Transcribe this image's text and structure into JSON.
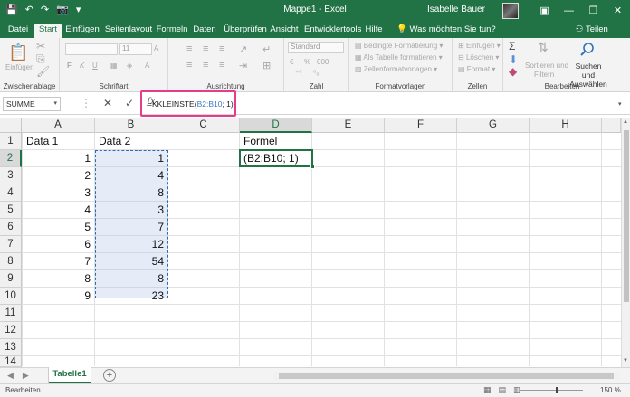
{
  "titlebar": {
    "title": "Mappe1  -  Excel",
    "user": "Isabelle Bauer",
    "minimize": "—",
    "restore": "❐",
    "close": "✕"
  },
  "tabs": [
    {
      "label": "Datei"
    },
    {
      "label": "Start"
    },
    {
      "label": "Einfügen"
    },
    {
      "label": "Seitenlayout"
    },
    {
      "label": "Formeln"
    },
    {
      "label": "Daten"
    },
    {
      "label": "Überprüfen"
    },
    {
      "label": "Ansicht"
    },
    {
      "label": "Entwicklertools"
    },
    {
      "label": "Hilfe"
    }
  ],
  "tellme": "Was möchten Sie tun?",
  "share": "Teilen",
  "ribbon": {
    "groups": {
      "clipboard": "Zwischenablage",
      "font": "Schriftart",
      "alignment": "Ausrichtung",
      "number": "Zahl",
      "styles": "Formatvorlagen",
      "cells": "Zellen",
      "editing": "Bearbeiten"
    },
    "paste": "Einfügen",
    "font_size": "11",
    "number_format": "Standard",
    "cond_format": "Bedingte Formatierung",
    "as_table": "Als Tabelle formatieren",
    "cell_styles": "Zellenformatvorlagen",
    "insert": "Einfügen",
    "delete": "Löschen",
    "format": "Format",
    "sort_filter_1": "Sortieren und",
    "sort_filter_2": "Filtern",
    "find_select_1": "Suchen und",
    "find_select_2": "Auswählen"
  },
  "formula_bar": {
    "name_box": "SUMME",
    "fx": "fx",
    "prefix": "=KKLEINSTE(",
    "ref": "B2:B10",
    "suffix": "; 1)"
  },
  "columns": [
    "A",
    "B",
    "C",
    "D",
    "E",
    "F",
    "G",
    "H"
  ],
  "rows": [
    "1",
    "2",
    "3",
    "4",
    "5",
    "6",
    "7",
    "8",
    "9",
    "10",
    "11",
    "12",
    "13",
    "14"
  ],
  "cells": {
    "A1": "Data 1",
    "B1": "Data 2",
    "D1": "Formel",
    "A2": "1",
    "A3": "2",
    "A4": "3",
    "A5": "4",
    "A6": "5",
    "A7": "6",
    "A8": "7",
    "A9": "8",
    "A10": "9",
    "B2": "1",
    "B3": "4",
    "B4": "8",
    "B5": "3",
    "B6": "7",
    "B7": "12",
    "B8": "54",
    "B9": "8",
    "B10": "23",
    "D2": "(B2:B10; 1)"
  },
  "sheet_tab": "Tabelle1",
  "status": {
    "mode": "Bearbeiten",
    "zoom": "150 %"
  },
  "colors": {
    "accent": "#217346",
    "highlight": "#e43d8a",
    "ref": "#3b78c4"
  }
}
